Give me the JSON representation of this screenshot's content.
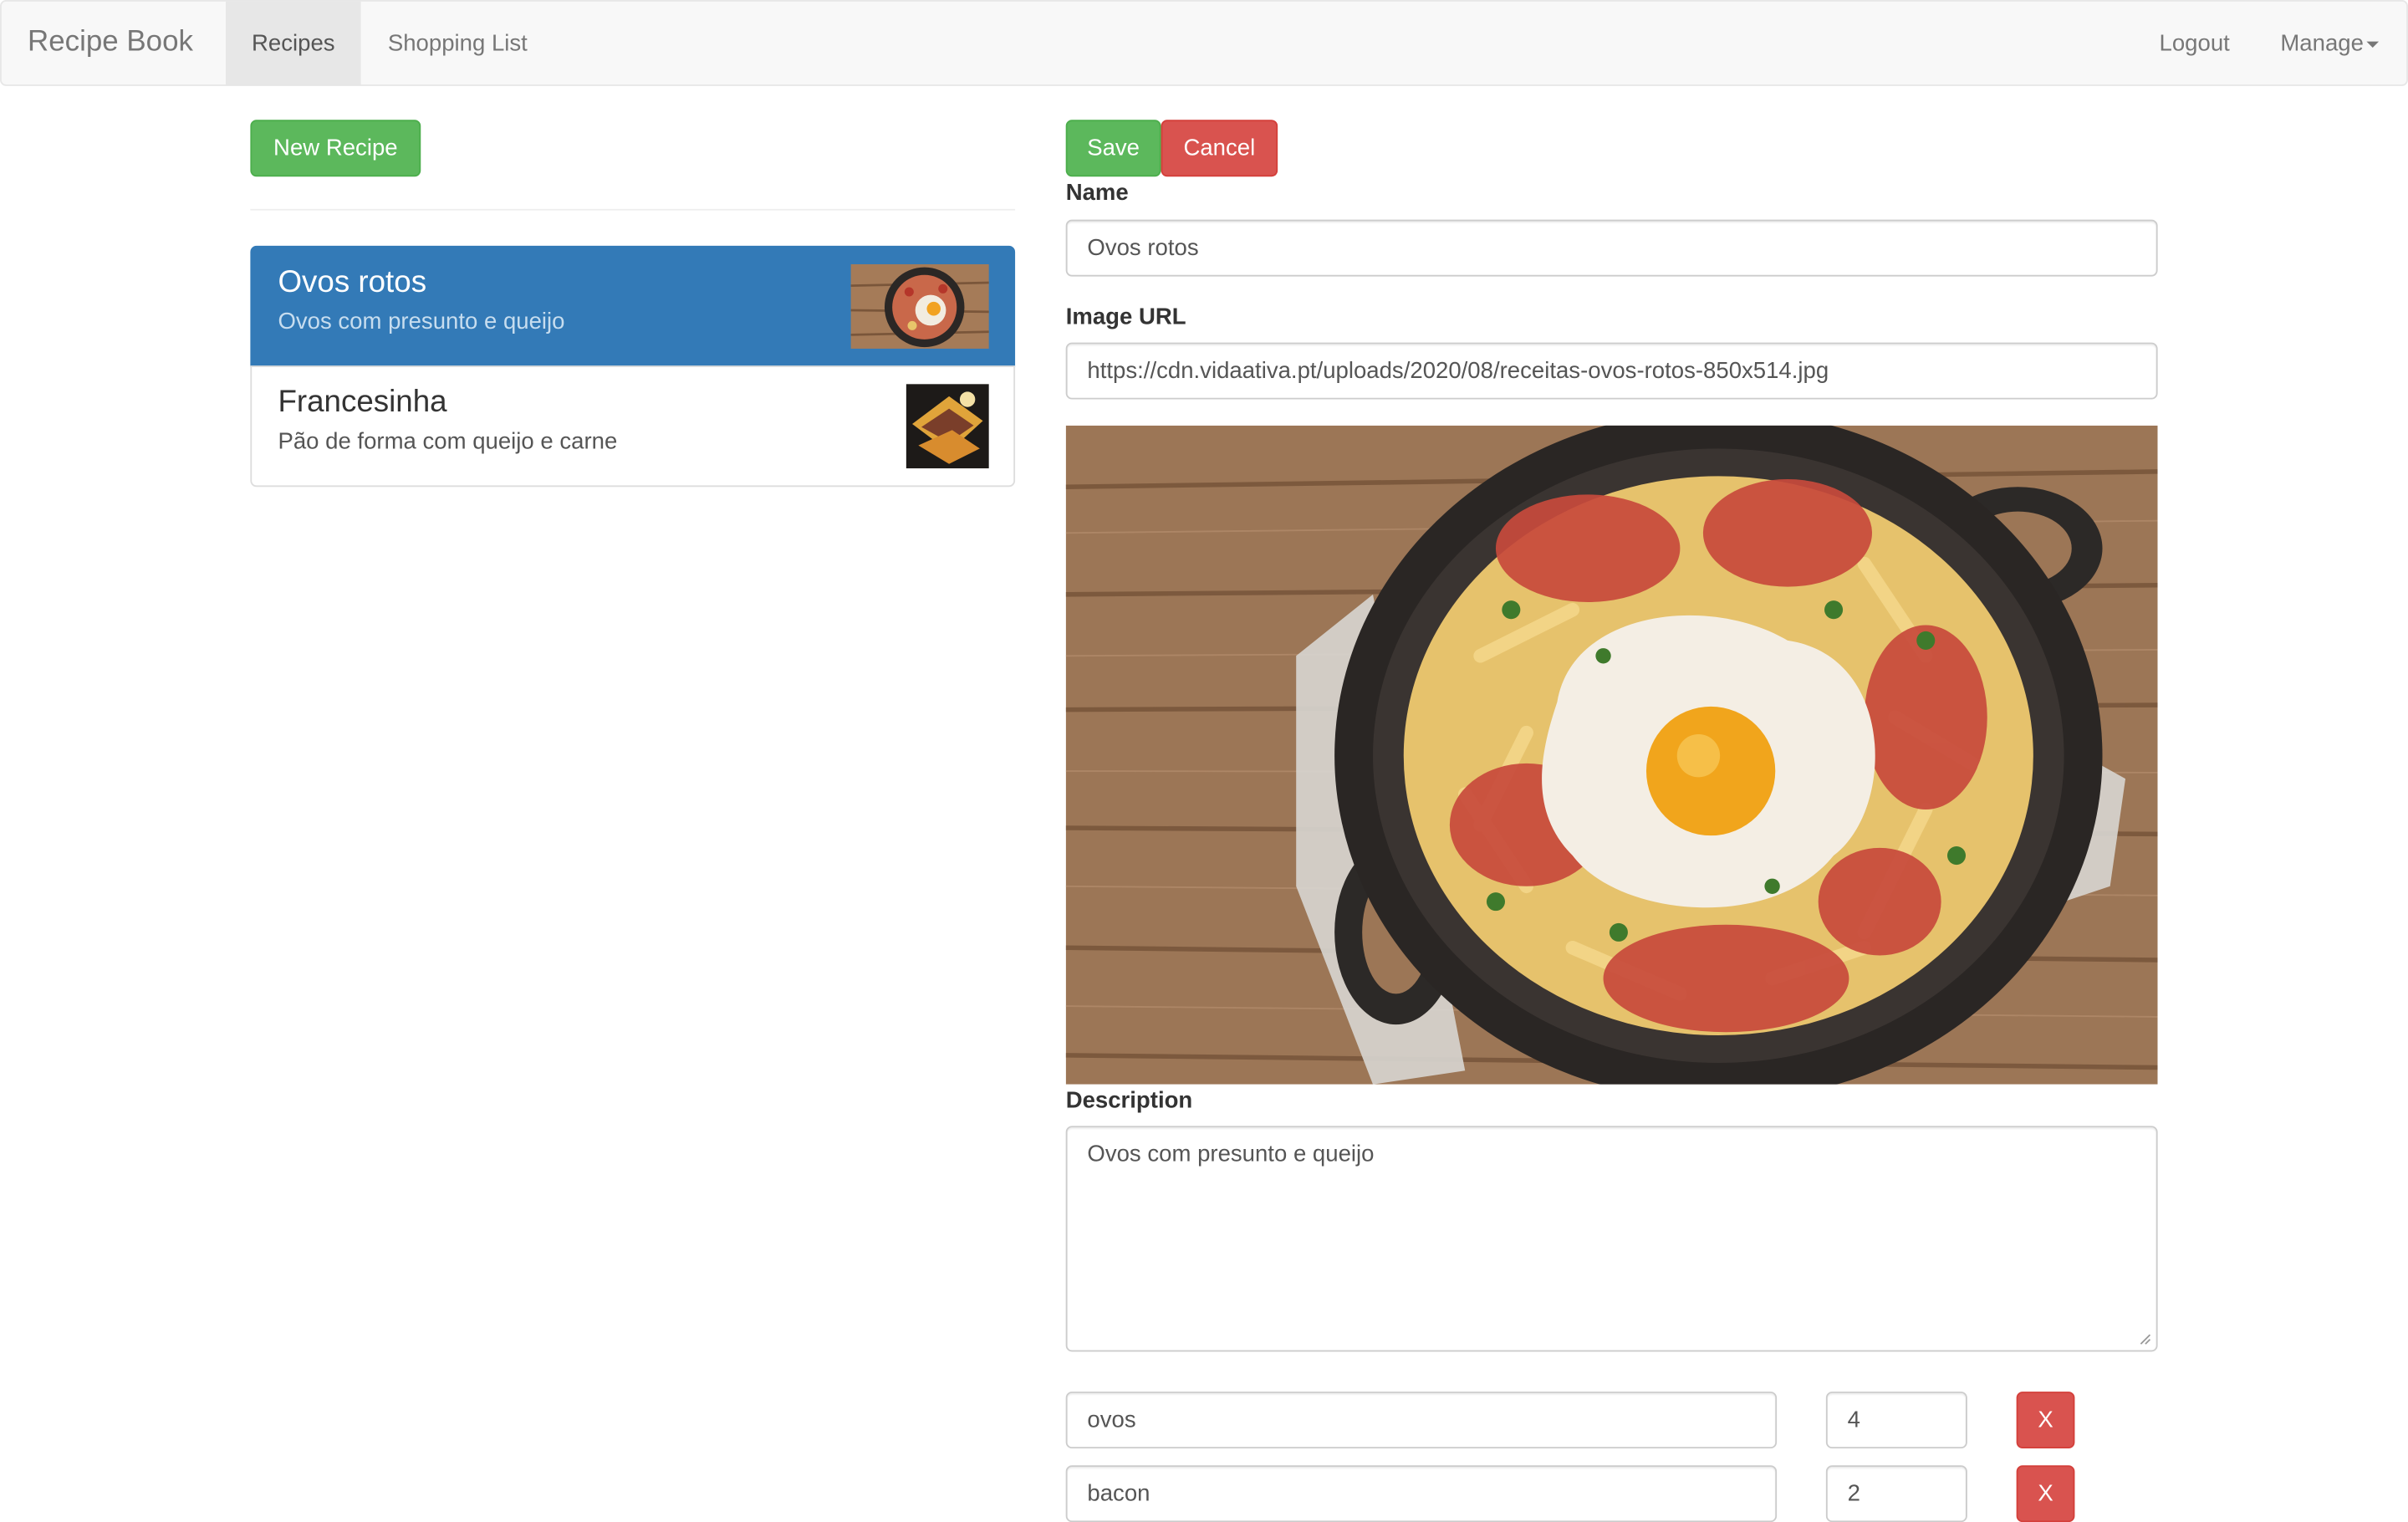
{
  "navbar": {
    "brand": "Recipe Book",
    "links": [
      "Recipes",
      "Shopping List"
    ],
    "logout": "Logout",
    "manage": "Manage"
  },
  "list": {
    "new_recipe": "New Recipe",
    "items": [
      {
        "name": "Ovos rotos",
        "description": "Ovos com presunto e queijo"
      },
      {
        "name": "Francesinha",
        "description": "Pão de forma com queijo e carne"
      }
    ]
  },
  "form": {
    "save": "Save",
    "cancel": "Cancel",
    "name_label": "Name",
    "name_value": "Ovos rotos",
    "image_label": "Image URL",
    "image_value": "https://cdn.vidaativa.pt/uploads/2020/08/receitas-ovos-rotos-850x514.jpg",
    "description_label": "Description",
    "description_value": "Ovos com presunto e queijo",
    "ingredients": [
      {
        "name": "ovos",
        "amount": "4"
      },
      {
        "name": "bacon",
        "amount": "2"
      }
    ],
    "remove_label": "X"
  },
  "colors": {
    "success": "#5cb85c",
    "danger": "#d9534f",
    "primary": "#337ab7",
    "navbar_bg": "#f8f8f8"
  }
}
